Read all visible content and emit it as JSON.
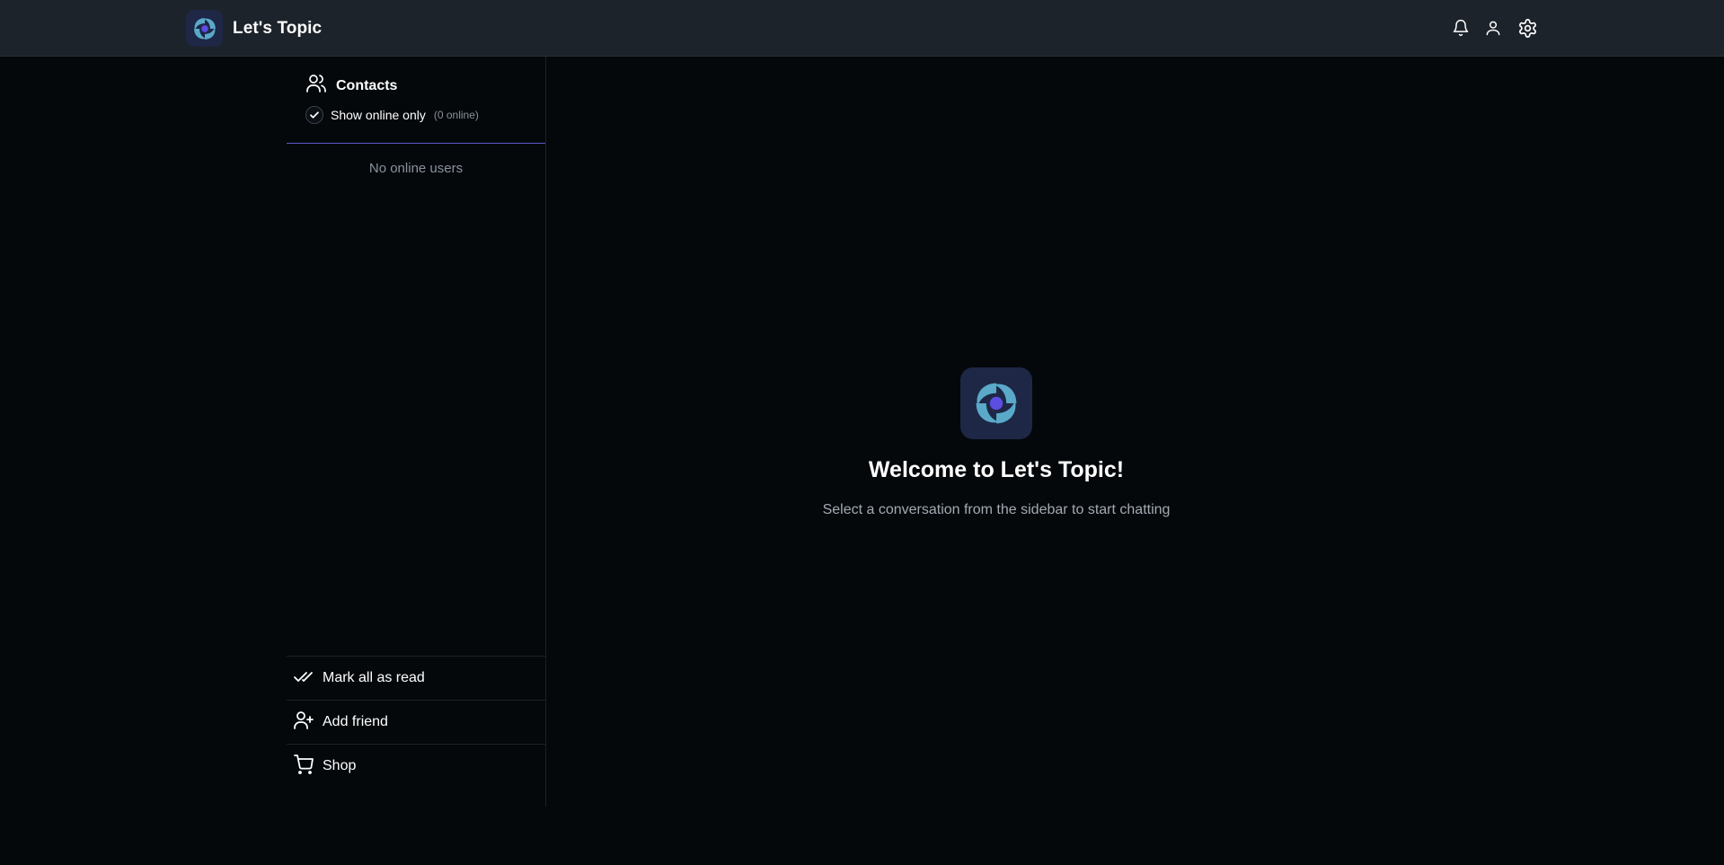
{
  "app": {
    "name": "Let's Topic",
    "accent": "#5b57c9",
    "logo_colors": {
      "background": "#1e2746",
      "swirl": "#5aa9c9",
      "dot": "#5b4ee0"
    }
  },
  "header": {
    "icons": [
      "bell-icon",
      "user-icon",
      "gear-icon"
    ]
  },
  "sidebar": {
    "title": "Contacts",
    "title_icon": "users-icon",
    "filter": {
      "label": "Show online only",
      "count": "(0 online)",
      "checked": true
    },
    "empty_message": "No online users",
    "actions": [
      {
        "label": "Mark all as read",
        "icon": "double-check-icon"
      },
      {
        "label": "Add friend",
        "icon": "user-plus-icon"
      },
      {
        "label": "Shop",
        "icon": "cart-icon"
      }
    ]
  },
  "main": {
    "welcome_title": "Welcome to Let's Topic!",
    "welcome_subtitle": "Select a conversation from the sidebar to start chatting"
  }
}
